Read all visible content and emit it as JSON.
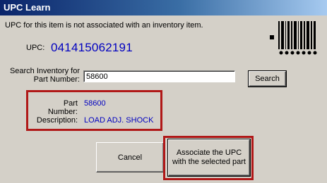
{
  "window": {
    "title": "UPC Learn"
  },
  "info_text": "UPC for this item is not associated with an inventory item.",
  "upc": {
    "label": "UPC:",
    "value": "041415062191"
  },
  "search": {
    "label_line1": "Search Inventory for",
    "label_line2": "Part Number:",
    "value": "58600",
    "button_label": "Search"
  },
  "part": {
    "number_label": "Part Number:",
    "number_value": "58600",
    "description_label": "Description:",
    "description_value": "LOAD ADJ. SHOCK"
  },
  "buttons": {
    "cancel_label": "Cancel",
    "associate_line1": "Associate the UPC",
    "associate_line2": "with the selected part"
  },
  "icons": {
    "barcode": "barcode-icon"
  },
  "colors": {
    "value_blue": "#0000c0",
    "highlight_red": "#b01818",
    "title_bar": "#0a246a"
  }
}
